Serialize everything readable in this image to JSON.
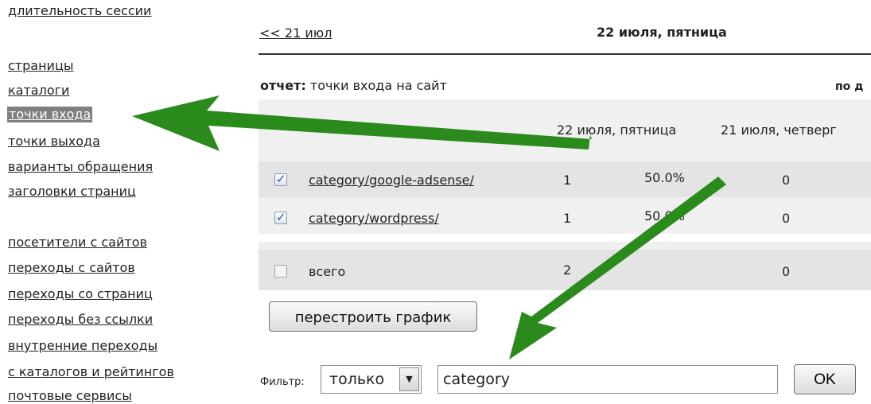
{
  "sidebar": {
    "items": [
      {
        "label": "длительность сессии"
      },
      {
        "label": "страницы"
      },
      {
        "label": "каталоги"
      },
      {
        "label": "точки входа"
      },
      {
        "label": "точки выхода"
      },
      {
        "label": "варианты обращения"
      },
      {
        "label": "заголовки страниц"
      },
      {
        "label": "посетители с сайтов"
      },
      {
        "label": "переходы с сайтов"
      },
      {
        "label": "переходы со страниц"
      },
      {
        "label": "переходы без ссылки"
      },
      {
        "label": "внутренние переходы"
      },
      {
        "label": "с каталогов и рейтингов"
      },
      {
        "label": "почтовые сервисы"
      }
    ]
  },
  "header": {
    "prev_day": "<< 21 июл",
    "current_day": "22 июля, пятница"
  },
  "report": {
    "label": "отчет:",
    "value": "точки входа на сайт",
    "by_label": "по д"
  },
  "table": {
    "columns": [
      "22 июля, пятница",
      "21 июля, четверг"
    ],
    "rows": [
      {
        "label": "category/google-adsense/",
        "checked": true,
        "count1": "1",
        "pct1": "50.0%",
        "count2": "0"
      },
      {
        "label": "category/wordpress/",
        "checked": true,
        "count1": "1",
        "pct1": "50.0%",
        "count2": "0"
      }
    ],
    "total": {
      "label": "всего",
      "checked": false,
      "count1": "2",
      "count2": "0"
    }
  },
  "rebuild_button": "перестроить график",
  "filter": {
    "label": "Фильтр:",
    "mode": "только",
    "value": "category",
    "ok": "OK"
  },
  "colors": {
    "arrow": "#2a8a1c",
    "highlight": "#7f7f7f",
    "row_shade": "#e4e4e4"
  }
}
